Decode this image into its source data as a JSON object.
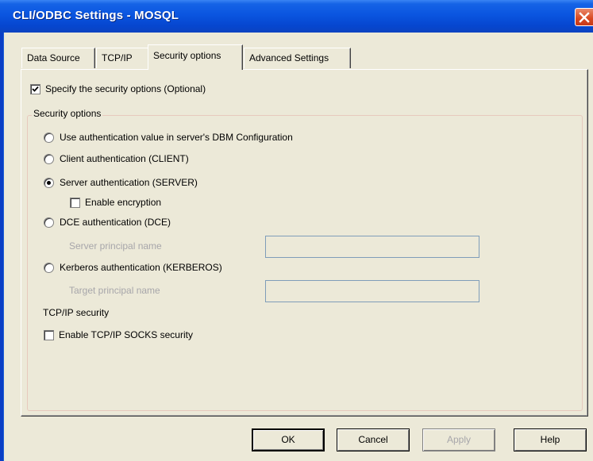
{
  "window": {
    "title": "CLI/ODBC Settings - MOSQL",
    "close_icon": "close-icon"
  },
  "tabs": [
    {
      "label": "Data Source",
      "active": false
    },
    {
      "label": "TCP/IP",
      "active": false
    },
    {
      "label": "Security options",
      "active": true
    },
    {
      "label": "Advanced Settings",
      "active": false
    }
  ],
  "specify_checkbox": {
    "label": "Specify the security options (Optional)",
    "checked": true
  },
  "security_group": {
    "caption": "Security options",
    "options": [
      {
        "label": "Use authentication value in server's DBM Configuration",
        "selected": false
      },
      {
        "label": "Client authentication (CLIENT)",
        "selected": false
      },
      {
        "label": "Server authentication (SERVER)",
        "selected": true
      },
      {
        "label": "DCE authentication (DCE)",
        "selected": false
      },
      {
        "label": "Kerberos authentication (KERBEROS)",
        "selected": false
      }
    ],
    "enable_encryption": {
      "label": "Enable encryption",
      "checked": false
    },
    "server_principal": {
      "label": "Server principal name",
      "value": ""
    },
    "target_principal": {
      "label": "Target principal name",
      "value": ""
    },
    "tcpip_heading": "TCP/IP security",
    "socks_checkbox": {
      "label": "Enable TCP/IP SOCKS security",
      "checked": false
    }
  },
  "buttons": {
    "ok": "OK",
    "cancel": "Cancel",
    "apply": "Apply",
    "help": "Help"
  },
  "colors": {
    "titlebar": "#0a55e0",
    "dialog_bg": "#ece9d8",
    "close_button": "#d8471f"
  }
}
